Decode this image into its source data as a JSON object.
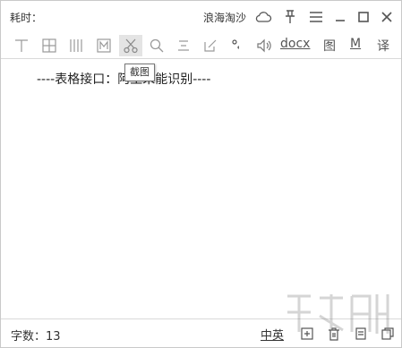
{
  "titlebar": {
    "elapsed_label": "耗时：",
    "username": "浪海淘沙"
  },
  "toolbar": {
    "docx_label": "docx",
    "image_label": "图",
    "m_label": "M",
    "translate_label": "译",
    "tooltip": "截图"
  },
  "content": {
    "text": "----表格接口：阿里未能识别----"
  },
  "statusbar": {
    "word_count": "字数：13",
    "lang_toggle": "中英"
  }
}
